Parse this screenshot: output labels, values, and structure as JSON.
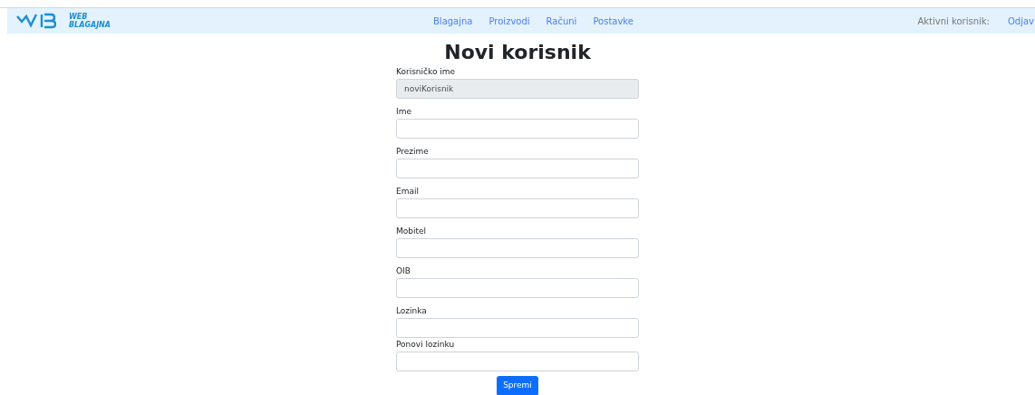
{
  "navbar": {
    "brand": "WEB BLAGAJNA",
    "links": [
      {
        "label": "Blagajna"
      },
      {
        "label": "Proizvodi"
      },
      {
        "label": "Računi"
      },
      {
        "label": "Postavke"
      }
    ],
    "active_user_label": "Aktivni korisnik:",
    "logout": "Odjav"
  },
  "title": "Novi korisnik",
  "fields": [
    {
      "label": "Korisničko ime",
      "value": "noviKorisnik",
      "disabled": true
    },
    {
      "label": "Ime",
      "disabled": false
    },
    {
      "label": "Prezime",
      "disabled": false
    },
    {
      "label": "Email",
      "disabled": false
    },
    {
      "label": "Mobitel",
      "disabled": false
    },
    {
      "label": "OIB",
      "disabled": false
    },
    {
      "label": "Lozinka",
      "disabled": false
    },
    {
      "label": "Ponovi lozinku",
      "disabled": false
    }
  ],
  "submit": "Spremi"
}
